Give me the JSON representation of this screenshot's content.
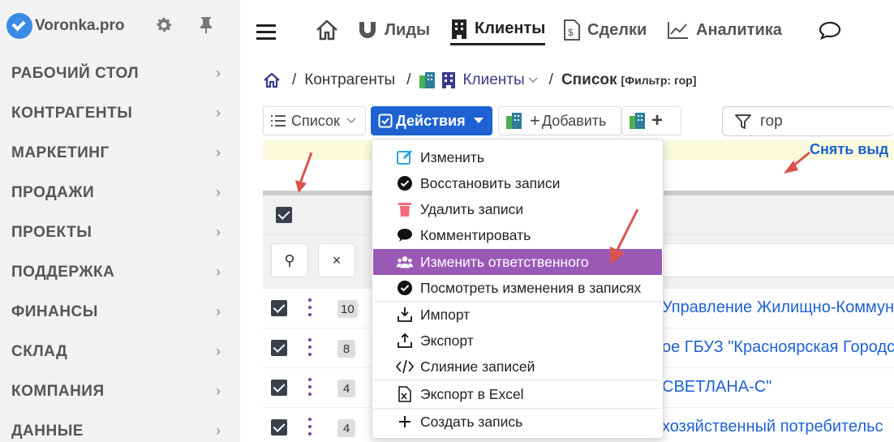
{
  "brand": {
    "name": "Voronka.pro"
  },
  "sidebar": {
    "items": [
      {
        "label": "РАБОЧИЙ СТОЛ"
      },
      {
        "label": "КОНТРАГЕНТЫ"
      },
      {
        "label": "МАРКЕТИНГ"
      },
      {
        "label": "ПРОДАЖИ"
      },
      {
        "label": "ПРОЕКТЫ"
      },
      {
        "label": "ПОДДЕРЖКА"
      },
      {
        "label": "ФИНАНСЫ"
      },
      {
        "label": "СКЛАД"
      },
      {
        "label": "КОМПАНИЯ"
      },
      {
        "label": "ДАННЫЕ"
      }
    ],
    "chevron": "›"
  },
  "topnav": {
    "tabs": [
      {
        "label": "Лиды",
        "icon": "magnet-icon"
      },
      {
        "label": "Клиенты",
        "icon": "building-icon",
        "active": true
      },
      {
        "label": "Сделки",
        "icon": "deal-document-icon"
      },
      {
        "label": "Аналитика",
        "icon": "chart-icon"
      }
    ]
  },
  "breadcrumb": {
    "sep": "/",
    "level1": "Контрагенты",
    "level2": "Клиенты",
    "current": "Список",
    "filter": "[Фильтр: гор]"
  },
  "toolbar": {
    "list_label": "Список",
    "actions_label": "Действия",
    "add_label": "Добавить",
    "add_plus": "+",
    "search_value": "гор"
  },
  "notice": {
    "link": "Снять выд"
  },
  "filter_row": {
    "search_glyph": "⚲",
    "clear_glyph": "×"
  },
  "dropdown": {
    "items": [
      {
        "label": "Изменить",
        "icon": "edit-icon"
      },
      {
        "label": "Восстановить записи",
        "icon": "check-circle-icon"
      },
      {
        "label": "Удалить записи",
        "icon": "trash-icon"
      },
      {
        "label": "Комментировать",
        "icon": "comment-icon"
      },
      {
        "label": "Изменить ответственного",
        "icon": "users-icon",
        "active": true
      },
      {
        "label": "Посмотреть изменения в записях",
        "icon": "check-circle-icon"
      },
      {
        "label": "Импорт",
        "icon": "import-icon"
      },
      {
        "label": "Экспорт",
        "icon": "export-icon"
      },
      {
        "label": "Слияние записей",
        "icon": "code-icon"
      },
      {
        "label": "Экспорт в Excel",
        "icon": "excel-icon"
      },
      {
        "label": "Создать запись",
        "icon": "plus-icon"
      }
    ]
  },
  "rows": [
    {
      "badge": "10",
      "text": "Управление Жилищно-Коммун"
    },
    {
      "badge": "8",
      "text": "ое ГБУЗ \"Красноярская Городск"
    },
    {
      "badge": "4",
      "text": "СВЕТЛАНА-С\""
    },
    {
      "badge": "4",
      "text": "хозяйственный потребительс"
    }
  ],
  "colors": {
    "primary": "#1e62d2",
    "highlight": "#9b59b6",
    "kebab": "#7b3fa6",
    "arrow": "#d9534f"
  }
}
